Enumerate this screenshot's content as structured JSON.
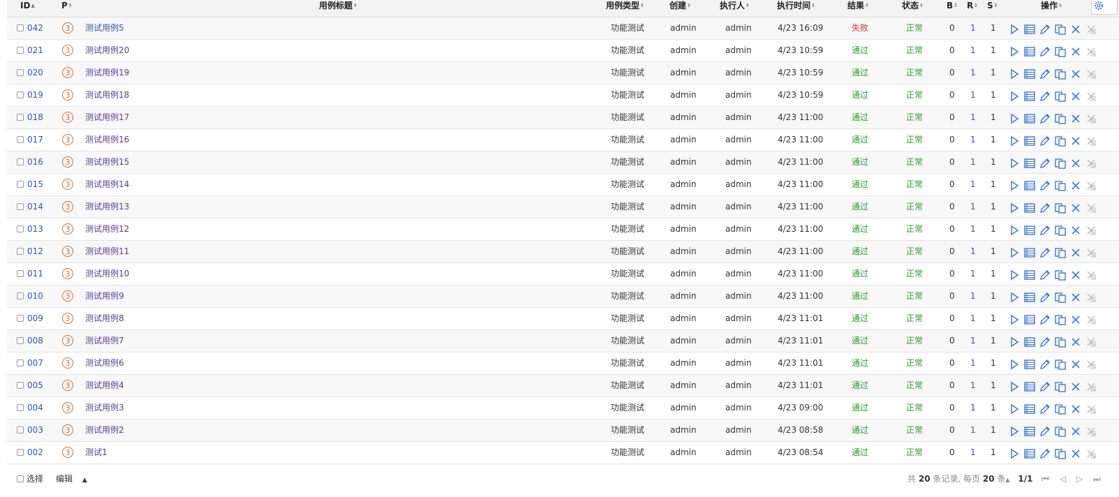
{
  "header": {
    "id": "ID",
    "p": "P",
    "title": "用例标题",
    "type": "用例类型",
    "creator": "创建",
    "executor": "执行人",
    "exec_time": "执行时间",
    "result": "结果",
    "status": "状态",
    "b": "B",
    "r": "R",
    "s": "S",
    "ops": "操作"
  },
  "rows": [
    {
      "id": "042",
      "p": "3",
      "title": "测试用例5",
      "type": "功能测试",
      "creator": "admin",
      "executor": "admin",
      "time": "4/23 16:09",
      "result": "失败",
      "status": "正常",
      "b": "0",
      "r": "1",
      "s": "1"
    },
    {
      "id": "021",
      "p": "3",
      "title": "测试用例20",
      "type": "功能测试",
      "creator": "admin",
      "executor": "admin",
      "time": "4/23 10:59",
      "result": "通过",
      "status": "正常",
      "b": "0",
      "r": "1",
      "s": "1"
    },
    {
      "id": "020",
      "p": "3",
      "title": "测试用例19",
      "type": "功能测试",
      "creator": "admin",
      "executor": "admin",
      "time": "4/23 10:59",
      "result": "通过",
      "status": "正常",
      "b": "0",
      "r": "1",
      "s": "1"
    },
    {
      "id": "019",
      "p": "3",
      "title": "测试用例18",
      "type": "功能测试",
      "creator": "admin",
      "executor": "admin",
      "time": "4/23 10:59",
      "result": "通过",
      "status": "正常",
      "b": "0",
      "r": "1",
      "s": "1"
    },
    {
      "id": "018",
      "p": "3",
      "title": "测试用例17",
      "type": "功能测试",
      "creator": "admin",
      "executor": "admin",
      "time": "4/23 11:00",
      "result": "通过",
      "status": "正常",
      "b": "0",
      "r": "1",
      "s": "1"
    },
    {
      "id": "017",
      "p": "3",
      "title": "测试用例16",
      "type": "功能测试",
      "creator": "admin",
      "executor": "admin",
      "time": "4/23 11:00",
      "result": "通过",
      "status": "正常",
      "b": "0",
      "r": "1",
      "s": "1"
    },
    {
      "id": "016",
      "p": "3",
      "title": "测试用例15",
      "type": "功能测试",
      "creator": "admin",
      "executor": "admin",
      "time": "4/23 11:00",
      "result": "通过",
      "status": "正常",
      "b": "0",
      "r": "1",
      "s": "1"
    },
    {
      "id": "015",
      "p": "3",
      "title": "测试用例14",
      "type": "功能测试",
      "creator": "admin",
      "executor": "admin",
      "time": "4/23 11:00",
      "result": "通过",
      "status": "正常",
      "b": "0",
      "r": "1",
      "s": "1"
    },
    {
      "id": "014",
      "p": "3",
      "title": "测试用例13",
      "type": "功能测试",
      "creator": "admin",
      "executor": "admin",
      "time": "4/23 11:00",
      "result": "通过",
      "status": "正常",
      "b": "0",
      "r": "1",
      "s": "1"
    },
    {
      "id": "013",
      "p": "3",
      "title": "测试用例12",
      "type": "功能测试",
      "creator": "admin",
      "executor": "admin",
      "time": "4/23 11:00",
      "result": "通过",
      "status": "正常",
      "b": "0",
      "r": "1",
      "s": "1"
    },
    {
      "id": "012",
      "p": "3",
      "title": "测试用例11",
      "type": "功能测试",
      "creator": "admin",
      "executor": "admin",
      "time": "4/23 11:00",
      "result": "通过",
      "status": "正常",
      "b": "0",
      "r": "1",
      "s": "1"
    },
    {
      "id": "011",
      "p": "3",
      "title": "测试用例10",
      "type": "功能测试",
      "creator": "admin",
      "executor": "admin",
      "time": "4/23 11:00",
      "result": "通过",
      "status": "正常",
      "b": "0",
      "r": "1",
      "s": "1"
    },
    {
      "id": "010",
      "p": "3",
      "title": "测试用例9",
      "type": "功能测试",
      "creator": "admin",
      "executor": "admin",
      "time": "4/23 11:00",
      "result": "通过",
      "status": "正常",
      "b": "0",
      "r": "1",
      "s": "1"
    },
    {
      "id": "009",
      "p": "3",
      "title": "测试用例8",
      "type": "功能测试",
      "creator": "admin",
      "executor": "admin",
      "time": "4/23 11:01",
      "result": "通过",
      "status": "正常",
      "b": "0",
      "r": "1",
      "s": "1"
    },
    {
      "id": "008",
      "p": "3",
      "title": "测试用例7",
      "type": "功能测试",
      "creator": "admin",
      "executor": "admin",
      "time": "4/23 11:01",
      "result": "通过",
      "status": "正常",
      "b": "0",
      "r": "1",
      "s": "1"
    },
    {
      "id": "007",
      "p": "3",
      "title": "测试用例6",
      "type": "功能测试",
      "creator": "admin",
      "executor": "admin",
      "time": "4/23 11:01",
      "result": "通过",
      "status": "正常",
      "b": "0",
      "r": "1",
      "s": "1"
    },
    {
      "id": "005",
      "p": "3",
      "title": "测试用例4",
      "type": "功能测试",
      "creator": "admin",
      "executor": "admin",
      "time": "4/23 11:01",
      "result": "通过",
      "status": "正常",
      "b": "0",
      "r": "1",
      "s": "1"
    },
    {
      "id": "004",
      "p": "3",
      "title": "测试用例3",
      "type": "功能测试",
      "creator": "admin",
      "executor": "admin",
      "time": "4/23 09:00",
      "result": "通过",
      "status": "正常",
      "b": "0",
      "r": "1",
      "s": "1"
    },
    {
      "id": "003",
      "p": "3",
      "title": "测试用例2",
      "type": "功能测试",
      "creator": "admin",
      "executor": "admin",
      "time": "4/23 08:58",
      "result": "通过",
      "status": "正常",
      "b": "0",
      "r": "1",
      "s": "1"
    },
    {
      "id": "002",
      "p": "3",
      "title": "测试1",
      "type": "功能测试",
      "creator": "admin",
      "executor": "admin",
      "time": "4/23 08:54",
      "result": "通过",
      "status": "正常",
      "b": "0",
      "r": "1",
      "s": "1"
    }
  ],
  "row_ops": [
    "run-icon",
    "results-list-icon",
    "edit-icon",
    "copy-icon",
    "delete-icon",
    "more-icon"
  ],
  "footer": {
    "select_label": "选择",
    "edit_label": "编辑",
    "total_prefix": "共",
    "total_count": "20",
    "total_suffix": "条记录,",
    "per_page_prefix": "每页",
    "per_page": "20",
    "per_page_suffix": "条",
    "page": "1/1"
  },
  "colors": {
    "link": "#2b5aa8",
    "pass": "#2a9d2a",
    "fail": "#d03030",
    "priority": "#d0702a",
    "icon": "#3a7ad9"
  }
}
